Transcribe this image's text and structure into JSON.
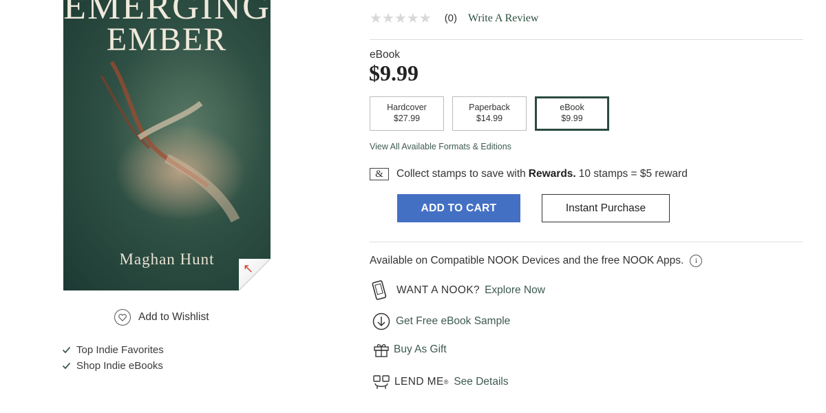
{
  "cover": {
    "title_line1": "EMERGING",
    "title_line2": "EMBER",
    "author": "Maghan Hunt"
  },
  "wishlist": {
    "label": "Add to Wishlist"
  },
  "collections": [
    "Top Indie Favorites",
    "Shop Indie eBooks"
  ],
  "rating": {
    "stars_filled": 0,
    "stars_total": 5,
    "count": "(0)",
    "write_review": "Write A Review"
  },
  "product": {
    "format": "eBook",
    "price": "$9.99"
  },
  "formats": [
    {
      "name": "Hardcover",
      "price": "$27.99",
      "selected": false
    },
    {
      "name": "Paperback",
      "price": "$14.99",
      "selected": false
    },
    {
      "name": "eBook",
      "price": "$9.99",
      "selected": true
    }
  ],
  "view_all": "View All Available Formats & Editions",
  "rewards": {
    "icon_text": "&",
    "prefix": "Collect stamps to save with",
    "brand": "Rewards.",
    "suffix": "10 stamps = $5 reward"
  },
  "buttons": {
    "add_to_cart": "ADD TO CART",
    "instant_purchase": "Instant Purchase"
  },
  "nook": {
    "available_text": "Available on Compatible NOOK Devices and the free NOOK Apps.",
    "info_icon": "i",
    "want_label": "WANT A NOOK?",
    "explore_link": "Explore Now",
    "sample_link": "Get Free eBook Sample",
    "gift_link": "Buy As Gift",
    "lend_label": "LEND ME",
    "lend_reg": "®",
    "details_link": "See Details"
  },
  "colors": {
    "accent_green": "#2b4a3e",
    "cart_blue": "#4470c4"
  }
}
